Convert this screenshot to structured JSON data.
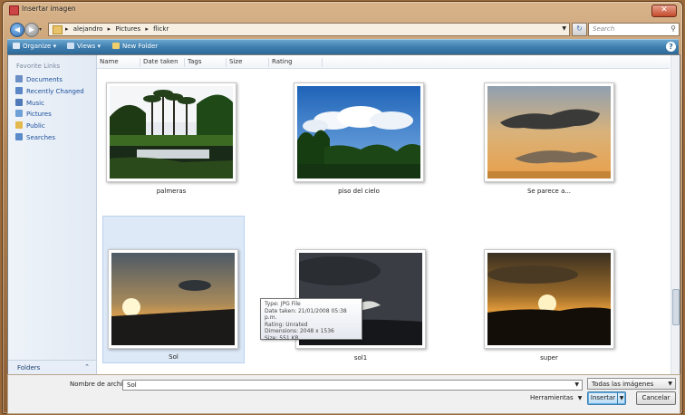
{
  "window": {
    "title": "Insertar imagen",
    "close_label": "✕"
  },
  "address": {
    "breadcrumbs": [
      "alejandro",
      "Pictures",
      "flickr"
    ],
    "separator": "▸",
    "search_placeholder": "Search"
  },
  "toolbar": {
    "organize": "Organize ▾",
    "views": "Views ▾",
    "new_folder": "New Folder"
  },
  "sidebar": {
    "heading": "Favorite Links",
    "items": [
      {
        "label": "Documents",
        "icon": "documents-icon",
        "color": "#6b8fc6"
      },
      {
        "label": "Recently Changed",
        "icon": "recent-icon",
        "color": "#5a86c8"
      },
      {
        "label": "Music",
        "icon": "music-icon",
        "color": "#4f79b8"
      },
      {
        "label": "Pictures",
        "icon": "pictures-icon",
        "color": "#6ea0d8"
      },
      {
        "label": "Public",
        "icon": "public-folder-icon",
        "color": "#e3b84d"
      },
      {
        "label": "Searches",
        "icon": "searches-icon",
        "color": "#5b8cc9"
      }
    ],
    "folders_label": "Folders"
  },
  "columns": [
    "Name",
    "Date taken",
    "Tags",
    "Size",
    "Rating"
  ],
  "files": [
    {
      "name": "palmeras"
    },
    {
      "name": "piso del cielo"
    },
    {
      "name": "Se parece a..."
    },
    {
      "name": "Sol"
    },
    {
      "name": "sol1"
    },
    {
      "name": "super"
    }
  ],
  "tooltip": {
    "type": "Type: JPG File",
    "date": "Date taken: 21/01/2008 05:38 p.m.",
    "rating": "Rating: Unrated",
    "dimensions": "Dimensions: 2048 x 1536",
    "size": "Size: 551 KB"
  },
  "footer": {
    "filename_label": "Nombre de archivo:",
    "filename_value": "Sol",
    "filter_value": "Todas las imágenes",
    "tools_label": "Herramientas",
    "insert_label": "Insertar",
    "cancel_label": "Cancelar"
  }
}
